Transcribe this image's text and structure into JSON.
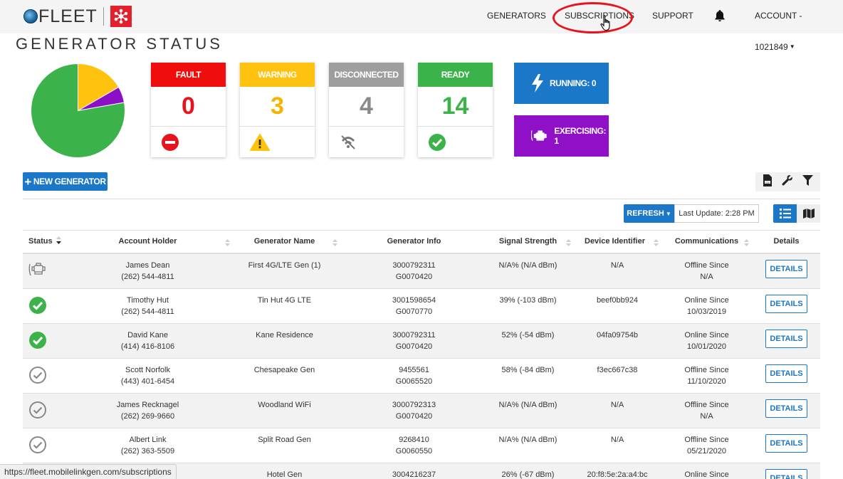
{
  "app": {
    "logo_text": "FLEET"
  },
  "nav": {
    "generators": "GENERATORS",
    "subscriptions": "SUBSCRIPTIONS",
    "support": "SUPPORT",
    "account": "ACCOUNT - 1021849",
    "bell_icon": "bell-icon"
  },
  "page_title": "GENERATOR STATUS",
  "status_pie": {
    "slices": [
      {
        "label": "ready",
        "value": 14,
        "color": "#3cb34a"
      },
      {
        "label": "warning",
        "value": 3,
        "color": "#ffc20e"
      },
      {
        "label": "exercising",
        "value": 1,
        "color": "#8b0fc7"
      }
    ]
  },
  "cards": [
    {
      "label": "FAULT",
      "count": "0",
      "color": "#f00d0d",
      "num_color": "#e8141d",
      "icon": "stop-icon"
    },
    {
      "label": "WARNING",
      "count": "3",
      "color": "#ffc20e",
      "num_color": "#f5b400",
      "icon": "warning-icon"
    },
    {
      "label": "DISCONNECTED",
      "count": "4",
      "color": "#9e9e9e",
      "num_color": "#8a8a8a",
      "icon": "disconnected-icon"
    },
    {
      "label": "READY",
      "count": "14",
      "color": "#3cb34a",
      "num_color": "#3cb34a",
      "icon": "check-icon"
    }
  ],
  "running": {
    "label": "RUNNING: 0",
    "color": "#1b77c8"
  },
  "exercising": {
    "label": "EXERCISING: 1",
    "color": "#9010c8"
  },
  "toolbar": {
    "new_generator": "NEW GENERATOR",
    "refresh": "REFRESH",
    "last_update": "Last Update: 2:28 PM"
  },
  "table": {
    "headers": [
      "Status",
      "Account Holder",
      "Generator Name",
      "Generator Info",
      "Signal Strength",
      "Device Identifier",
      "Communications",
      "Details"
    ],
    "rows": [
      {
        "status": "disconnected",
        "holder": "James Dean",
        "phone": "(262) 544-4811",
        "gen_name": "First 4G/LTE Gen (1)",
        "info1": "3000792311",
        "info2": "G0070420",
        "signal": "N/A% (N/A dBm)",
        "device": "N/A",
        "comm1": "Offline Since",
        "comm2": "N/A",
        "details": "DETAILS"
      },
      {
        "status": "ready",
        "holder": "Timothy Hut",
        "phone": "(262) 544-4811",
        "gen_name": "Tin Hut 4G LTE",
        "info1": "3001598654",
        "info2": "G0070770",
        "signal": "39% (-103 dBm)",
        "device": "beef0bb924",
        "comm1": "Online Since",
        "comm2": "10/03/2019",
        "details": "DETAILS"
      },
      {
        "status": "ready",
        "holder": "David Kane",
        "phone": "(414) 416-8106",
        "gen_name": "Kane Residence",
        "info1": "3000792311",
        "info2": "G0070420",
        "signal": "52% (-54 dBm)",
        "device": "04fa09754b",
        "comm1": "Online Since",
        "comm2": "10/01/2020",
        "details": "DETAILS"
      },
      {
        "status": "offline",
        "holder": "Scott Norfolk",
        "phone": "(443) 401-6454",
        "gen_name": "Chesapeake Gen",
        "info1": "9455561",
        "info2": "G0065520",
        "signal": "58% (-84 dBm)",
        "device": "f3ec667c38",
        "comm1": "Offline Since",
        "comm2": "11/10/2020",
        "details": "DETAILS"
      },
      {
        "status": "offline",
        "holder": "James Recknagel",
        "phone": "(262) 269-9660",
        "gen_name": "Woodland WiFi",
        "info1": "3000792313",
        "info2": "G0070420",
        "signal": "N/A% (N/A dBm)",
        "device": "N/A",
        "comm1": "Offline Since",
        "comm2": "N/A",
        "details": "DETAILS"
      },
      {
        "status": "offline",
        "holder": "Albert Link",
        "phone": "(262) 363-5509",
        "gen_name": "Split Road Gen",
        "info1": "9268410",
        "info2": "G0060550",
        "signal": "N/A% (N/A dBm)",
        "device": "N/A",
        "comm1": "Offline Since",
        "comm2": "05/21/2020",
        "details": "DETAILS"
      },
      {
        "status": "ready",
        "holder": "",
        "phone": "",
        "gen_name": "Hotel Gen",
        "info1": "3004216237",
        "info2": "",
        "signal": "26% (-67 dBm)",
        "device": "20:f8:5e:2a:a4:bc",
        "comm1": "Online Since",
        "comm2": "",
        "details": "DETAILS"
      }
    ]
  },
  "status_bar_url": "https://fleet.mobilelinkgen.com/subscriptions"
}
